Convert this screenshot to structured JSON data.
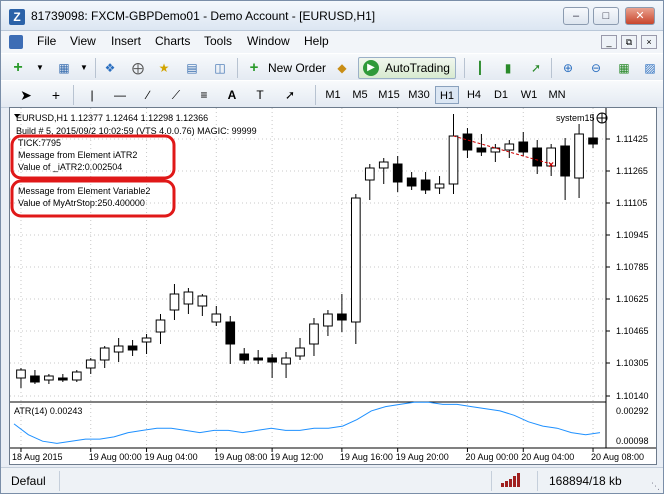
{
  "window": {
    "title": "81739098: FXCM-GBPDemo01 - Demo Account - [EURUSD,H1]",
    "app_icon_glyph": "Z"
  },
  "menu": [
    "File",
    "View",
    "Insert",
    "Charts",
    "Tools",
    "Window",
    "Help"
  ],
  "toolbar": {
    "new_order_label": "New Order",
    "autotrading_label": "AutoTrading"
  },
  "timeframes": [
    "M1",
    "M5",
    "M15",
    "M30",
    "H1",
    "H4",
    "D1",
    "W1",
    "MN"
  ],
  "active_timeframe": "H1",
  "chart": {
    "symbol_line": "EURUSD,H1  1.12377 1.12464 1.12298 1.12366",
    "build_line": "Build # 5, 2015/09/2 10:02:59  (VTS 4.0.0.76) MAGIC: 99999",
    "ea_label": "system15",
    "comments": [
      "TICK:7795",
      "Message from Element iATR2",
      "Value of _iATR2:0.002504",
      "",
      "Message from Element Variable2",
      "Value of MyAtrStop:250.400000"
    ],
    "price_ticks": [
      "1.11425",
      "1.11265",
      "1.11105",
      "1.10945",
      "1.10785",
      "1.10625",
      "1.10465",
      "1.10305",
      "1.10140"
    ],
    "indicator_label": "ATR(14) 0.00243",
    "indicator_ticks": [
      "0.00292",
      "0.00098"
    ],
    "time_labels": [
      "18 Aug 2015",
      "19 Aug 00:00",
      "19 Aug 04:00",
      "19 Aug 08:00",
      "19 Aug 12:00",
      "19 Aug 16:00",
      "19 Aug 20:00",
      "20 Aug 00:00",
      "20 Aug 04:00",
      "20 Aug 08:00"
    ],
    "colors": {
      "highlight": "#e01818",
      "atr_line": "#1e90ff",
      "trade_line": "#cc0000"
    }
  },
  "chart_data": {
    "type": "candlestick",
    "ylim": [
      1.1012,
      1.1158
    ],
    "candles": [
      {
        "o": 1.1023,
        "h": 1.1028,
        "l": 1.1018,
        "c": 1.1027
      },
      {
        "o": 1.1024,
        "h": 1.1027,
        "l": 1.102,
        "c": 1.1021
      },
      {
        "o": 1.1022,
        "h": 1.1025,
        "l": 1.102,
        "c": 1.1024
      },
      {
        "o": 1.1023,
        "h": 1.1025,
        "l": 1.1021,
        "c": 1.1022
      },
      {
        "o": 1.1022,
        "h": 1.1027,
        "l": 1.1021,
        "c": 1.1026
      },
      {
        "o": 1.1028,
        "h": 1.1033,
        "l": 1.1025,
        "c": 1.1032
      },
      {
        "o": 1.1032,
        "h": 1.1039,
        "l": 1.1028,
        "c": 1.1038
      },
      {
        "o": 1.1036,
        "h": 1.1043,
        "l": 1.1031,
        "c": 1.1039
      },
      {
        "o": 1.1039,
        "h": 1.1042,
        "l": 1.1034,
        "c": 1.1037
      },
      {
        "o": 1.1041,
        "h": 1.1045,
        "l": 1.1035,
        "c": 1.1043
      },
      {
        "o": 1.1046,
        "h": 1.1055,
        "l": 1.104,
        "c": 1.1052
      },
      {
        "o": 1.1057,
        "h": 1.107,
        "l": 1.1052,
        "c": 1.1065
      },
      {
        "o": 1.106,
        "h": 1.1068,
        "l": 1.1055,
        "c": 1.1066
      },
      {
        "o": 1.1059,
        "h": 1.1065,
        "l": 1.1054,
        "c": 1.1064
      },
      {
        "o": 1.1051,
        "h": 1.1059,
        "l": 1.1049,
        "c": 1.1055
      },
      {
        "o": 1.1051,
        "h": 1.1054,
        "l": 1.103,
        "c": 1.104
      },
      {
        "o": 1.1035,
        "h": 1.1038,
        "l": 1.103,
        "c": 1.1032
      },
      {
        "o": 1.1033,
        "h": 1.1037,
        "l": 1.103,
        "c": 1.1032
      },
      {
        "o": 1.1033,
        "h": 1.1035,
        "l": 1.1023,
        "c": 1.1031
      },
      {
        "o": 1.103,
        "h": 1.1036,
        "l": 1.1023,
        "c": 1.1033
      },
      {
        "o": 1.1034,
        "h": 1.1043,
        "l": 1.1032,
        "c": 1.1038
      },
      {
        "o": 1.104,
        "h": 1.1053,
        "l": 1.1034,
        "c": 1.105
      },
      {
        "o": 1.1049,
        "h": 1.1057,
        "l": 1.1044,
        "c": 1.1055
      },
      {
        "o": 1.1055,
        "h": 1.1065,
        "l": 1.1046,
        "c": 1.1052
      },
      {
        "o": 1.1051,
        "h": 1.1115,
        "l": 1.104,
        "c": 1.1113
      },
      {
        "o": 1.1122,
        "h": 1.113,
        "l": 1.1112,
        "c": 1.1128
      },
      {
        "o": 1.1128,
        "h": 1.1133,
        "l": 1.112,
        "c": 1.1131
      },
      {
        "o": 1.113,
        "h": 1.1134,
        "l": 1.1116,
        "c": 1.1121
      },
      {
        "o": 1.1123,
        "h": 1.1126,
        "l": 1.1117,
        "c": 1.1119
      },
      {
        "o": 1.1122,
        "h": 1.1126,
        "l": 1.1115,
        "c": 1.1117
      },
      {
        "o": 1.1118,
        "h": 1.1124,
        "l": 1.1115,
        "c": 1.112
      },
      {
        "o": 1.112,
        "h": 1.1155,
        "l": 1.1115,
        "c": 1.1144
      },
      {
        "o": 1.1145,
        "h": 1.1148,
        "l": 1.1133,
        "c": 1.1137
      },
      {
        "o": 1.1138,
        "h": 1.1145,
        "l": 1.1134,
        "c": 1.1136
      },
      {
        "o": 1.1136,
        "h": 1.114,
        "l": 1.1131,
        "c": 1.1138
      },
      {
        "o": 1.1137,
        "h": 1.1142,
        "l": 1.1133,
        "c": 1.114
      },
      {
        "o": 1.1141,
        "h": 1.1146,
        "l": 1.1134,
        "c": 1.1136
      },
      {
        "o": 1.1138,
        "h": 1.1142,
        "l": 1.1125,
        "c": 1.1129
      },
      {
        "o": 1.1129,
        "h": 1.114,
        "l": 1.1124,
        "c": 1.1138
      },
      {
        "o": 1.1139,
        "h": 1.1143,
        "l": 1.1112,
        "c": 1.1124
      },
      {
        "o": 1.1123,
        "h": 1.115,
        "l": 1.1113,
        "c": 1.1145
      },
      {
        "o": 1.1143,
        "h": 1.1155,
        "l": 1.1138,
        "c": 1.114
      }
    ],
    "atr": {
      "name": "ATR(14)",
      "last": 0.00243,
      "ylim": [
        0.00098,
        0.00292
      ],
      "values": [
        0.002,
        0.0015,
        0.0012,
        0.0011,
        0.0012,
        0.0013,
        0.0013,
        0.0014,
        0.0016,
        0.0017,
        0.0018,
        0.0018,
        0.0017,
        0.0016,
        0.0017,
        0.0017,
        0.0016,
        0.0017,
        0.0018,
        0.0017,
        0.0017,
        0.0018,
        0.0018,
        0.0019,
        0.0022,
        0.0026,
        0.0028,
        0.0029,
        0.003,
        0.003,
        0.0029,
        0.0029,
        0.0028,
        0.0027,
        0.0026,
        0.0024,
        0.0021,
        0.0019,
        0.0018,
        0.0016,
        0.0015,
        0.0016
      ]
    }
  }
}
